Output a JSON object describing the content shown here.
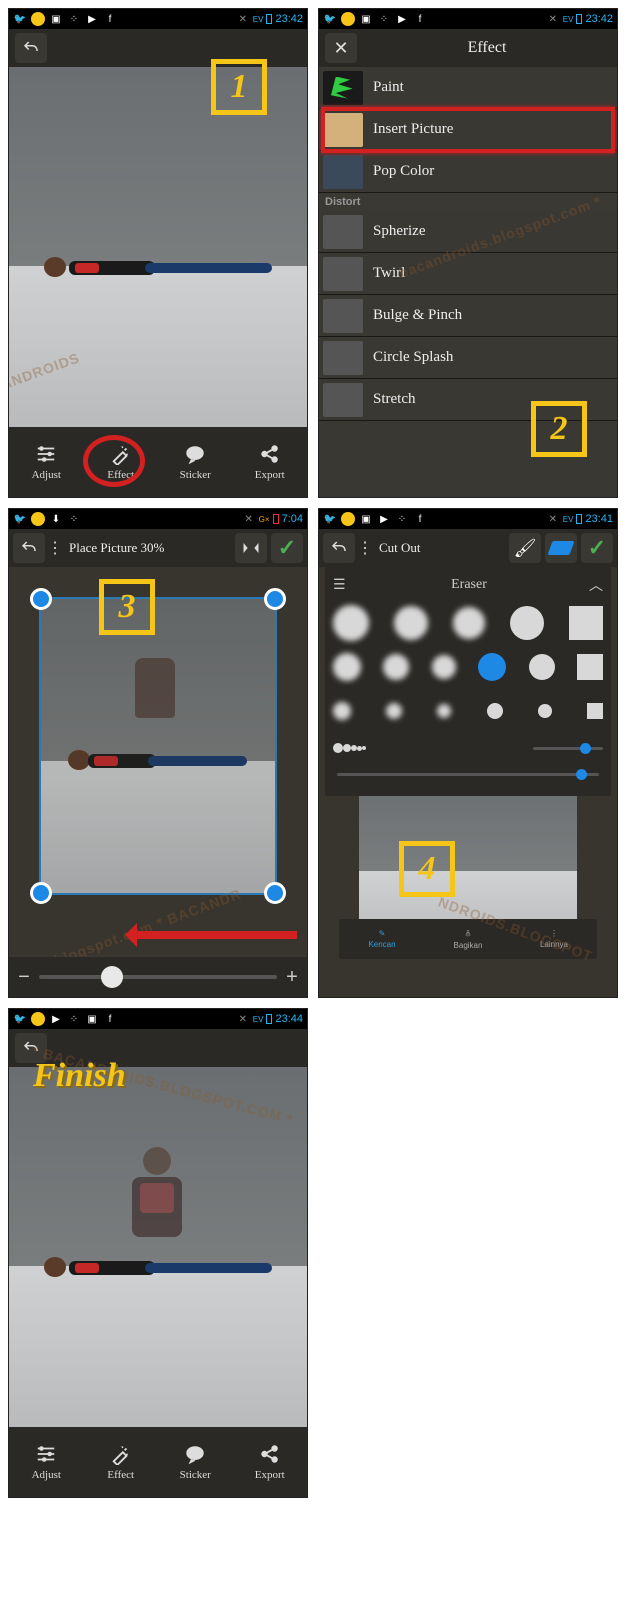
{
  "status": {
    "time1": "23:42",
    "time2": "23:42",
    "time3": "7:04",
    "time4": "23:41",
    "time5": "23:44"
  },
  "badges": {
    "b1": "1",
    "b2": "2",
    "b3": "3",
    "b4": "4",
    "finish": "Finish"
  },
  "bottombar": {
    "adjust": "Adjust",
    "effect": "Effect",
    "sticker": "Sticker",
    "export": "Export"
  },
  "effect_panel": {
    "title": "Effect",
    "items": [
      "Paint",
      "Insert Picture",
      "Pop Color"
    ],
    "category": "Distort",
    "distort": [
      "Spherize",
      "Twirl",
      "Bulge & Pinch",
      "Circle Splash",
      "Stretch"
    ]
  },
  "place": {
    "title": "Place Picture 30%"
  },
  "cutout": {
    "title": "Cut Out",
    "eraser": "Eraser",
    "sub": {
      "a": "Kencan",
      "b": "Bagikan",
      "c": "Lainnya"
    }
  },
  "slider": {
    "minus": "−",
    "plus": "+"
  }
}
